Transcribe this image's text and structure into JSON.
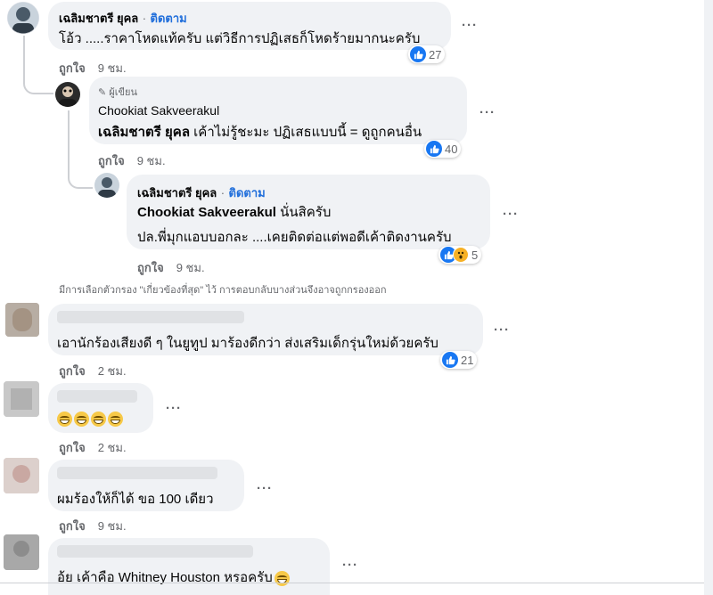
{
  "colors": {
    "accent": "#216fdb",
    "like_blue": "#1877f2",
    "bubble": "#f0f2f5",
    "meta": "#65676b"
  },
  "comment1": {
    "author": "เฉลิมชาตรี ยุคล",
    "separator": "·",
    "follow": "ติดตาม",
    "text": "โอ้ว .....ราคาโหดแท้ครับ แต่วิธีการปฏิเสธก็โหดร้ายมากนะครับ",
    "like_label": "ถูกใจ",
    "time": "9 ชม.",
    "reaction_count": "27"
  },
  "reply1": {
    "badge": "ผู้เขียน",
    "author": "Chookiat Sakveerakul",
    "mention": "เฉลิมชาตรี ยุคล",
    "text": " เค้าไม่รู้ชะมะ ปฏิเสธแบบนี้ = ดูถูกคนอื่น",
    "like_label": "ถูกใจ",
    "time": "9 ชม.",
    "reaction_count": "40"
  },
  "reply2": {
    "author": "เฉลิมชาตรี ยุคล",
    "separator": "·",
    "follow": "ติดตาม",
    "mention": "Chookiat Sakveerakul",
    "text_line1": " นั่นสิครับ",
    "text_line2": "ปล.พี่มุกแอบบอกละ ....เคยติดต่อแต่พอดีเค้าติดงานครับ",
    "like_label": "ถูกใจ",
    "time": "9 ชม.",
    "reaction_count": "5"
  },
  "filter_notice": "มีการเลือกตัวกรอง \"เกี่ยวข้องที่สุด\" ไว้ การตอบกลับบางส่วนจึงอาจถูกกรองออก",
  "comment2": {
    "text": "เอานักร้องเสียงดี ๆ ในยูทูป มาร้องดีกว่า ส่งเสริมเด็กรุ่นใหม่ด้วยครับ",
    "like_label": "ถูกใจ",
    "time": "2 ชม.",
    "reaction_count": "21"
  },
  "comment3": {
    "like_label": "ถูกใจ",
    "time": "2 ชม."
  },
  "comment4": {
    "text": "ผมร้องให้ก็ได้ ขอ 100 เดียว",
    "like_label": "ถูกใจ",
    "time": "9 ชม."
  },
  "comment5": {
    "text": "อ้ย เค้าคือ Whitney Houston หรอครับ"
  },
  "more_label": "···"
}
